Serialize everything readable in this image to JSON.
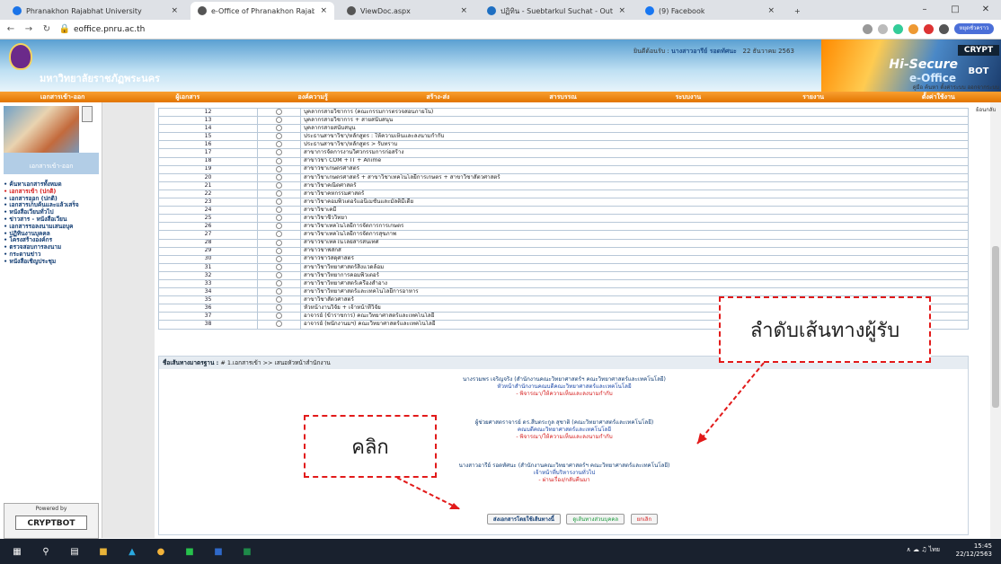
{
  "browser": {
    "tabs": [
      {
        "title": "Phranakhon Rajabhat University",
        "active": false
      },
      {
        "title": "e-Office of Phranakhon Rajabhat",
        "active": true
      },
      {
        "title": "ViewDoc.aspx",
        "active": false
      },
      {
        "title": "ปฏิทิน - Suebtarkul Suchat - Outl",
        "active": false
      },
      {
        "title": "(9) Facebook",
        "active": false
      }
    ],
    "url": "eoffice.pnru.ac.th",
    "profile_label": "หยุดชั่วคราว"
  },
  "banner": {
    "university": "มหาวิทยาลัยราชภัฏพระนคร",
    "welcome_prefix": "ยินดีต้อนรับ :",
    "user": "นางสาวอารีย์ รอดทัศนะ",
    "date": "22 ธันวาคม 2563",
    "links": "คู่มือ  ค้นหา  ตั้งค่าระบบ  ออกจากระบบ",
    "brand_hi_trusted": "Hi-Trusted",
    "brand_crypt": "CRYPT",
    "brand_secure": "Hi-Secure",
    "brand_eoffice": "e-Office",
    "brand_bot": "BOT"
  },
  "menu": [
    "เอกสารเข้า-ออก",
    "ผู้เอกสาร",
    "องค์ความรู้",
    "สร้าง-ส่ง",
    "สารบรรณ",
    "ระบบงาน",
    "รายงาน",
    "ตั้งค่าใช้งาน"
  ],
  "sidebar": {
    "header": "เอกสารเข้า-ออก",
    "items": [
      {
        "label": "ค้นหาเอกสารทั้งหมด",
        "selected": false
      },
      {
        "label": "เอกสารเข้า (ปกติ)",
        "selected": true
      },
      {
        "label": "เอกสารออก (ปกติ)",
        "selected": false
      },
      {
        "label": "เอกสารเก็บค้นและแล้วเสร็จ",
        "selected": false
      },
      {
        "label": "หนังสือเวียนทั่วไป",
        "selected": false
      },
      {
        "label": "ข่าวสาร - หนังสือเวียน",
        "selected": false
      },
      {
        "label": "เอกสารรอลงนามเสนอบุค",
        "selected": false
      },
      {
        "label": "ปฏิทินงานบุคคล",
        "selected": false
      },
      {
        "label": "โครงสร้างองค์กร",
        "selected": false
      },
      {
        "label": "ตรวจสอบการลงนาม",
        "selected": false
      },
      {
        "label": "กระดานข่าว",
        "selected": false
      },
      {
        "label": "หนังสือเชิญประชุม",
        "selected": false
      }
    ],
    "powered_by": "Powered by",
    "cryptbot": "CRYPTBOT"
  },
  "page_button": "ย้อนกลับ",
  "recipients": [
    {
      "no": "12",
      "name": "บุคลากรสายวิชาการ (คณะกรรมการตรวจสอบภายใน)"
    },
    {
      "no": "13",
      "name": "บุคลากรสายวิชาการ + สายสนับสนุน"
    },
    {
      "no": "14",
      "name": "บุคลากรสายสนับสนุน"
    },
    {
      "no": "15",
      "name": "ประธานสาขาวิชา/หลักสูตร : ให้ความเห็นและลงนามกำกับ"
    },
    {
      "no": "16",
      "name": "ประธานสาขาวิชา/หลักสูตร > รับทราบ"
    },
    {
      "no": "17",
      "name": "สาขาการจัดการงานวิศวกรรมการก่อสร้าง"
    },
    {
      "no": "18",
      "name": "สาขาวิชา COM + IT + Anime"
    },
    {
      "no": "19",
      "name": "สาขาวิชาเกษตรศาสตร์"
    },
    {
      "no": "20",
      "name": "สาขาวิชาเกษตรศาสตร์ + สาขาวิชาเทคโนโลยีการเกษตร + สาขาวิชาสัตวศาสตร์"
    },
    {
      "no": "21",
      "name": "สาขาวิชาคณิตศาสตร์"
    },
    {
      "no": "22",
      "name": "สาขาวิชาคหกรรมศาสตร์"
    },
    {
      "no": "23",
      "name": "สาขาวิชาคอมพิวเตอร์แอนิเมชันและมัลติมีเดีย"
    },
    {
      "no": "24",
      "name": "สาขาวิชาเคมี"
    },
    {
      "no": "25",
      "name": "สาขาวิชาชีววิทยา"
    },
    {
      "no": "26",
      "name": "สาขาวิชาเทคโนโลยีการจัดการการเกษตร"
    },
    {
      "no": "27",
      "name": "สาขาวิชาเทคโนโลยีการจัดการสุขภาพ"
    },
    {
      "no": "28",
      "name": "สาขาวิชาเทคโนโลยีสารสนเทศ"
    },
    {
      "no": "29",
      "name": "สาขาวิชาฟิสิกส์"
    },
    {
      "no": "30",
      "name": "สาขาวิชาวัสดุศาสตร์"
    },
    {
      "no": "31",
      "name": "สาขาวิชาวิทยาศาสตร์สิ่งแวดล้อม"
    },
    {
      "no": "32",
      "name": "สาขาวิชาวิทยาการคอมพิวเตอร์"
    },
    {
      "no": "33",
      "name": "สาขาวิชาวิทยาศาสตร์เครื่องสำอาง"
    },
    {
      "no": "34",
      "name": "สาขาวิชาวิทยาศาสตร์และเทคโนโลยีการอาหาร"
    },
    {
      "no": "35",
      "name": "สาขาวิชาสัตวศาสตร์"
    },
    {
      "no": "36",
      "name": "หัวหน้างานวิจัย + เจ้าหน้าที่วิจัย"
    },
    {
      "no": "37",
      "name": "อาจารย์ (ข้าราชการ) คณะวิทยาศาสตร์และเทคโนโลยี"
    },
    {
      "no": "38",
      "name": "อาจารย์ (พนักงานมฯ) คณะวิทยาศาสตร์และเทคโนโลยี"
    }
  ],
  "route": {
    "label": "ชื่อเส้นทางมาตรฐาน :",
    "value": "# 1.เอกสารเข้า >> เสนอหัวหน้าสำนักงาน",
    "steps": [
      {
        "name": "นางรวมพร เจริญจริง (สำนักงานคณะวิทยาศาสตร์ฯ คณะวิทยาศาสตร์และเทคโนโลยี)",
        "role": "หัวหน้าสำนักงานคณบดีคณะวิทยาศาสตร์และเทคโนโลยี",
        "status": "- พิจารณา/ให้ความเห็นและลงนามกำกับ",
        "status_color": "red"
      },
      {
        "name": "ผู้ช่วยศาสตราจารย์ ดร.สืบตระกูล สุชาติ (คณะวิทยาศาสตร์และเทคโนโลยี)",
        "role": "คณบดีคณะวิทยาศาสตร์และเทคโนโลยี",
        "status": "- พิจารณา/ให้ความเห็นและลงนามกำกับ",
        "status_color": "red"
      },
      {
        "name": "นางสาวอารีย์ รอดทัศนะ (สำนักงานคณะวิทยาศาสตร์ฯ คณะวิทยาศาสตร์และเทคโนโลยี)",
        "role": "เจ้าหน้าที่บริหารงานทั่วไป",
        "status": "- ผ่านเรื่อง/กลับคืนมา",
        "status_color": "red"
      }
    ]
  },
  "buttons": {
    "send": "ส่งเอกสารโดยใช้เส้นทางนี้",
    "personal_route": "ดูเส้นทางส่วนบุคคล",
    "cancel": "ยกเลิก"
  },
  "annotations": {
    "route_order": "ลำดับเส้นทางผู้รับ",
    "click": "คลิก"
  },
  "taskbar": {
    "time": "15:45",
    "date": "22/12/2563",
    "lang": "ไทย"
  }
}
